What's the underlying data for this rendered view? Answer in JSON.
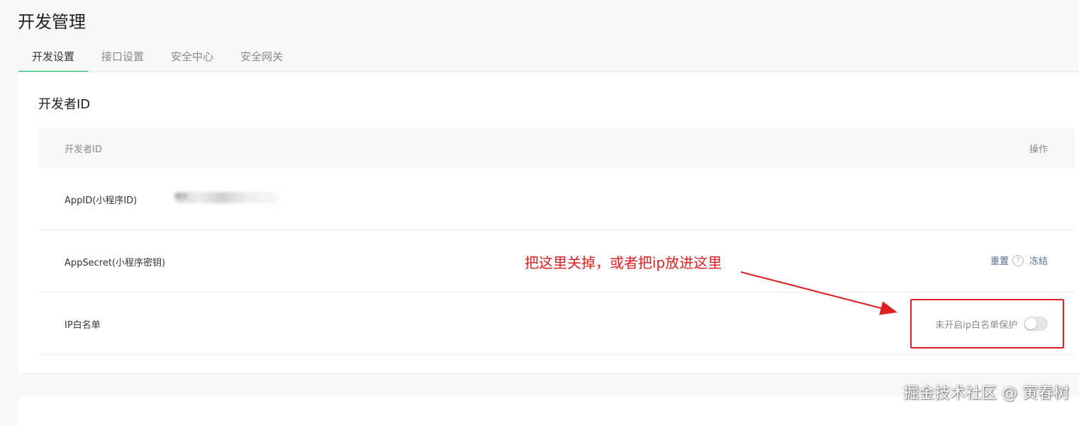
{
  "page_title": "开发管理",
  "tabs": [
    {
      "label": "开发设置",
      "active": true
    },
    {
      "label": "接口设置",
      "active": false
    },
    {
      "label": "安全中心",
      "active": false
    },
    {
      "label": "安全网关",
      "active": false
    }
  ],
  "section": {
    "title": "开发者ID",
    "table": {
      "headers": {
        "name": "开发者ID",
        "ops": "操作"
      },
      "rows": [
        {
          "label": "AppID(小程序ID)",
          "value": "wx"
        },
        {
          "label": "AppSecret(小程序密钥)",
          "reset": "重置",
          "freeze": "冻结"
        },
        {
          "label": "IP白名单",
          "status": "未开启ip白名单保护",
          "toggle_on": false
        }
      ]
    }
  },
  "annotation": {
    "text": "把这里关掉，或者把ip放进这里",
    "color": "#e02020"
  },
  "watermark": "掘金技术社区 @ 寅春树",
  "colors": {
    "accent": "#07c160",
    "link": "#576b95",
    "annotation": "#e02020"
  }
}
